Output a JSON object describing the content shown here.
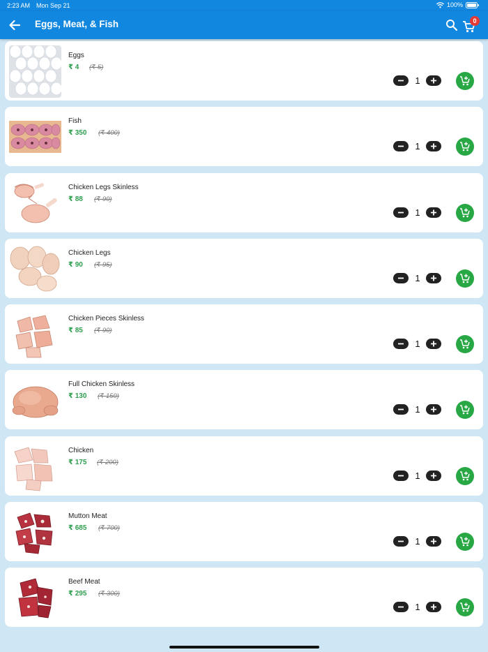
{
  "status_bar": {
    "time": "2:23 AM",
    "date": "Mon Sep 21",
    "battery": "100%"
  },
  "header": {
    "title": "Eggs, Meat, & Fish",
    "back_icon": "arrow-left-icon",
    "search_icon": "search-icon",
    "cart_icon": "cart-icon",
    "cart_count": "0"
  },
  "colors": {
    "app_bar": "#1187e0",
    "background": "#cfe6f5",
    "price_green": "#2e9e4f",
    "add_button": "#28a745",
    "badge": "#e53935"
  },
  "products": [
    {
      "name": "Eggs",
      "price": "₹ 4",
      "mrp": "(₹ 5)",
      "qty": "1"
    },
    {
      "name": "Fish",
      "price": "₹ 350",
      "mrp": "(₹ 400)",
      "qty": "1"
    },
    {
      "name": "Chicken Legs Skinless",
      "price": "₹ 88",
      "mrp": "(₹ 90)",
      "qty": "1"
    },
    {
      "name": "Chicken Legs",
      "price": "₹ 90",
      "mrp": "(₹ 95)",
      "qty": "1"
    },
    {
      "name": "Chicken Pieces Skinless",
      "price": "₹ 85",
      "mrp": "(₹ 90)",
      "qty": "1"
    },
    {
      "name": "Full Chicken Skinless",
      "price": "₹ 130",
      "mrp": "(₹ 150)",
      "qty": "1"
    },
    {
      "name": "Chicken",
      "price": "₹ 175",
      "mrp": "(₹ 200)",
      "qty": "1"
    },
    {
      "name": "Mutton Meat",
      "price": "₹ 685",
      "mrp": "(₹ 700)",
      "qty": "1"
    },
    {
      "name": "Beef Meat",
      "price": "₹ 295",
      "mrp": "(₹ 300)",
      "qty": "1"
    }
  ]
}
